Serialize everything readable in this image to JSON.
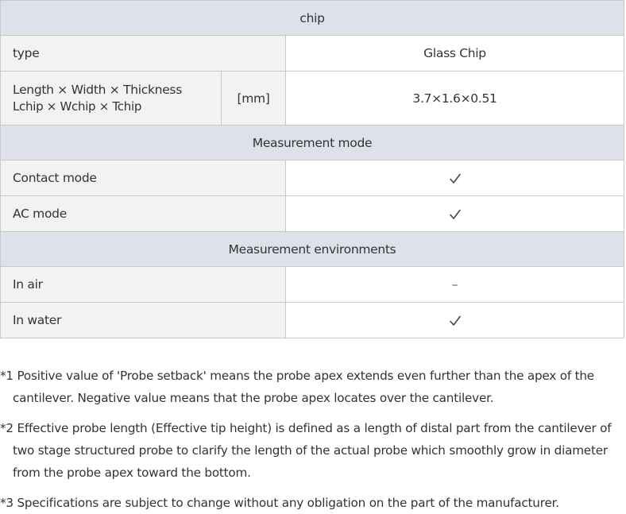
{
  "table": {
    "chip_header": "chip",
    "type_label": "type",
    "type_value": "Glass Chip",
    "dims_label": "Length × Width × Thickness",
    "dims_sublabel": "Lchip × Wchip × Tchip",
    "dims_unit": "[mm]",
    "dims_value": "3.7×1.6×0.51",
    "mode_header": "Measurement mode",
    "contact_label": "Contact mode",
    "contact_value": "check",
    "ac_label": "AC mode",
    "ac_value": "check",
    "env_header": "Measurement environments",
    "air_label": "In air",
    "air_value": "–",
    "water_label": "In water",
    "water_value": "check"
  },
  "notes": [
    "*1 Positive value of 'Probe setback' means the probe apex extends even further than the apex of the cantilever. Negative value means that the probe apex locates over the cantilever.",
    "*2 Effective probe length (Effective tip height) is defined as a length of distal part from the cantilever of two stage structured probe to clarify the length of the actual probe which smoothly grow in diameter from the probe apex toward the bottom.",
    "*3 Specifications are subject to change without any obligation on the part of the manufacturer."
  ]
}
